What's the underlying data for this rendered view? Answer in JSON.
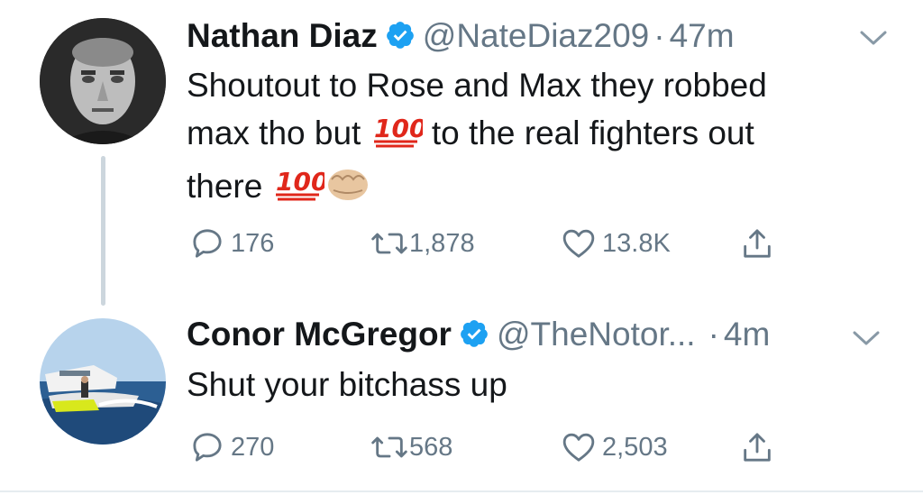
{
  "tweets": [
    {
      "name": "Nathan Diaz",
      "handle": "@NateDiaz209",
      "separator": "·",
      "time": "47m",
      "text_line1": "Shoutout to Rose and Max they robbed",
      "text_line2a": "max tho but",
      "text_line2b": "to the real fighters out",
      "text_line3": "there",
      "emoji_100": "💯",
      "emoji_fist": "👊",
      "replies": "176",
      "retweets": "1,878",
      "likes": "13.8K"
    },
    {
      "name": "Conor McGregor",
      "handle": "@TheNotor...",
      "separator": "·",
      "time": "4m",
      "text": "Shut your bitchass up",
      "replies": "270",
      "retweets": "568",
      "likes": "2,503"
    }
  ],
  "colors": {
    "text": "#14171a",
    "secondary": "#657786",
    "verified": "#1da1f2",
    "thread_line": "#ccd6dd"
  },
  "icons": {
    "verified": "verified-badge-icon",
    "chevron": "chevron-down-icon",
    "reply": "reply-icon",
    "retweet": "retweet-icon",
    "like": "heart-icon",
    "share": "share-icon"
  }
}
